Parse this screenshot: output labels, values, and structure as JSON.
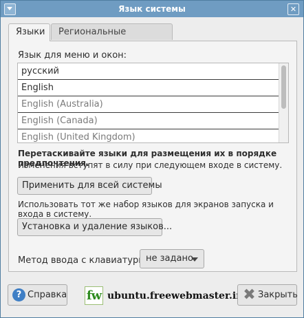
{
  "window": {
    "title": "Язык системы",
    "close_glyph": "✕"
  },
  "tabs": [
    {
      "label": "Языки",
      "active": true
    },
    {
      "label": "Региональные форматы",
      "active": false
    }
  ],
  "languages": {
    "label": "Язык для меню и окон:",
    "items": [
      "русский",
      "English",
      "English (Australia)",
      "English (Canada)",
      "English (United Kingdom)"
    ]
  },
  "hints": {
    "drag": "Перетаскивайте языки для размещения их в порядке предпочтения.",
    "apply_next_login": "Изменения вступят в силу при следующем входе в систему.",
    "login_screen": "Использовать тот же набор языков для экранов запуска и входа в систему."
  },
  "buttons": {
    "apply_system_wide": "Применить для всей системы",
    "install_remove": "Установка и удаление языков...",
    "help": "Справка",
    "close": "Закрыть"
  },
  "input_method": {
    "label": "Метод ввода с клавиатуры:",
    "value": "не задано"
  },
  "watermark": {
    "logo_text": "fw",
    "site": "ubuntu.freewebmaster.info"
  },
  "icons": {
    "help": "help-icon",
    "close": "close-icon",
    "window": "window-menu-icon",
    "dropdown": "chevron-down-icon"
  }
}
